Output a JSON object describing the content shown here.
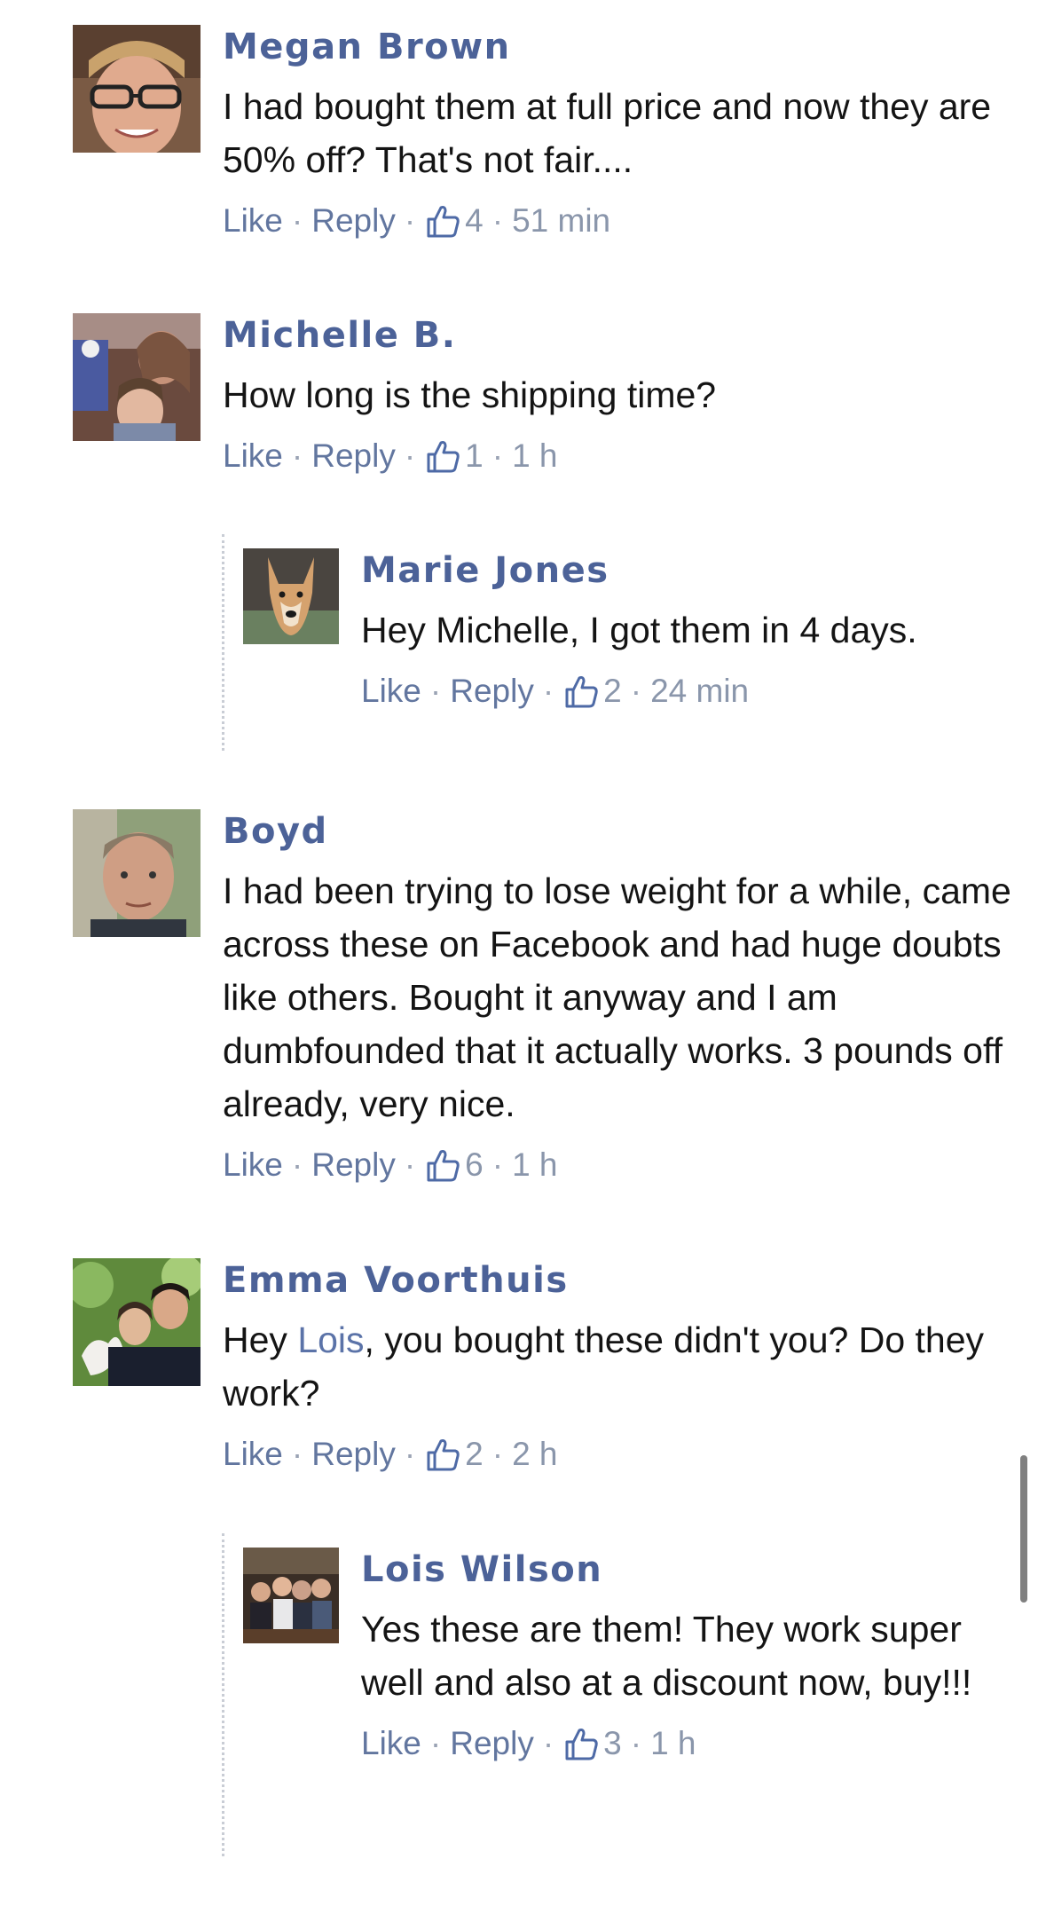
{
  "actions": {
    "like": "Like",
    "reply": "Reply",
    "dot": "·"
  },
  "comments": [
    {
      "name": "Megan Brown",
      "text": "I had bought them at full price and now they are 50% off? That's not fair....",
      "likes": "4",
      "time": "51 min"
    },
    {
      "name": "Michelle B.",
      "text": "How long is the shipping time?",
      "likes": "1",
      "time": "1 h"
    },
    {
      "name": "Marie Jones",
      "text": "Hey Michelle, I got them in 4 days.",
      "likes": "2",
      "time": "24 min"
    },
    {
      "name": "Boyd",
      "text": "I had been trying to lose weight for a while, came across these on Facebook and had huge doubts like others. Bought it anyway and I am dumbfounded that it actually works. 3 pounds off already, very nice.",
      "likes": "6",
      "time": "1 h"
    },
    {
      "name": "Emma Voorthuis",
      "text_before": "Hey ",
      "mention": "Lois",
      "text_after": ", you bought these didn't you? Do they work?",
      "likes": "2",
      "time": "2 h"
    },
    {
      "name": "Lois Wilson",
      "text": "Yes these are them! They work super well and also at a discount now, buy!!!",
      "likes": "3",
      "time": "1 h"
    }
  ],
  "colors": {
    "name": "#4c6298",
    "link": "#62769f",
    "meta": "#8a96ab",
    "text": "#141414"
  },
  "icons": {
    "like": "thumbs-up-icon"
  }
}
